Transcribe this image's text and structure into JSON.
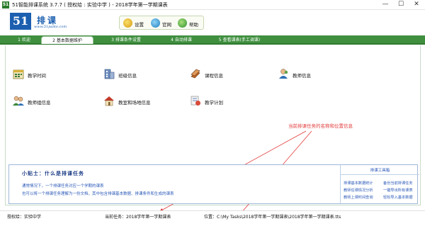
{
  "window": {
    "title": "51智能排课系统 3.7.7 ( 授权给 : 实验中学 ) - 2018学年第一学期课表",
    "app_icon": "51",
    "minimize": "—",
    "maximize": "☐",
    "close": "✕"
  },
  "logo": {
    "brand_number": "51",
    "brand_name": "排课",
    "url": "www.51paike.com"
  },
  "toolbar": {
    "settings_label": "设置",
    "website_label": "官网",
    "help_label": "帮助"
  },
  "tabs": [
    {
      "label": "1 欢迎",
      "active": false
    },
    {
      "label": "2 基本数据维护",
      "active": true
    },
    {
      "label": "3 排课条件设置",
      "active": false
    },
    {
      "label": "4 自动排课",
      "active": false
    },
    {
      "label": "5 查看课表(手工调课)",
      "active": false
    }
  ],
  "modules": {
    "teaching_time": "教学时间",
    "class_info": "班级信息",
    "course_info": "课程信息",
    "teacher_info": "教师信息",
    "teacher_group_info": "教师组信息",
    "classroom_venue_info": "教室和场地信息",
    "teaching_plan": "教学计划"
  },
  "annotation": "当前排课任务的名称和位置信息",
  "tips": {
    "heading": "小贴士：什么是排课任务",
    "line1": "通常情况下，一个排课任务对应一个学期的课表",
    "line2": "也可以将一个排课任务理解为一份文档，其中包含排课基本数据、排课条件和生成的课表"
  },
  "task_tools": {
    "heading": "排课工具箱",
    "links": [
      "排课基本数据统计",
      "备份当前排课任务",
      "教师任课情况分析",
      "一键导出所有课表",
      "教师上课时间查询",
      "轻松导入基本数据"
    ]
  },
  "status": {
    "authorized": "授权给：实验中学",
    "current_task": "当前任务：2018学年第一学期课表",
    "location": "位置：C:\\My Tasks\\2018学年第一学期课表\\2018学年第一学期课表.tts"
  },
  "colors": {
    "tab_bar_green": "#3f8f3f",
    "brand_blue": "#1c5fb0",
    "annotation_red": "#e23a3a",
    "link_blue": "#2a58b8"
  }
}
